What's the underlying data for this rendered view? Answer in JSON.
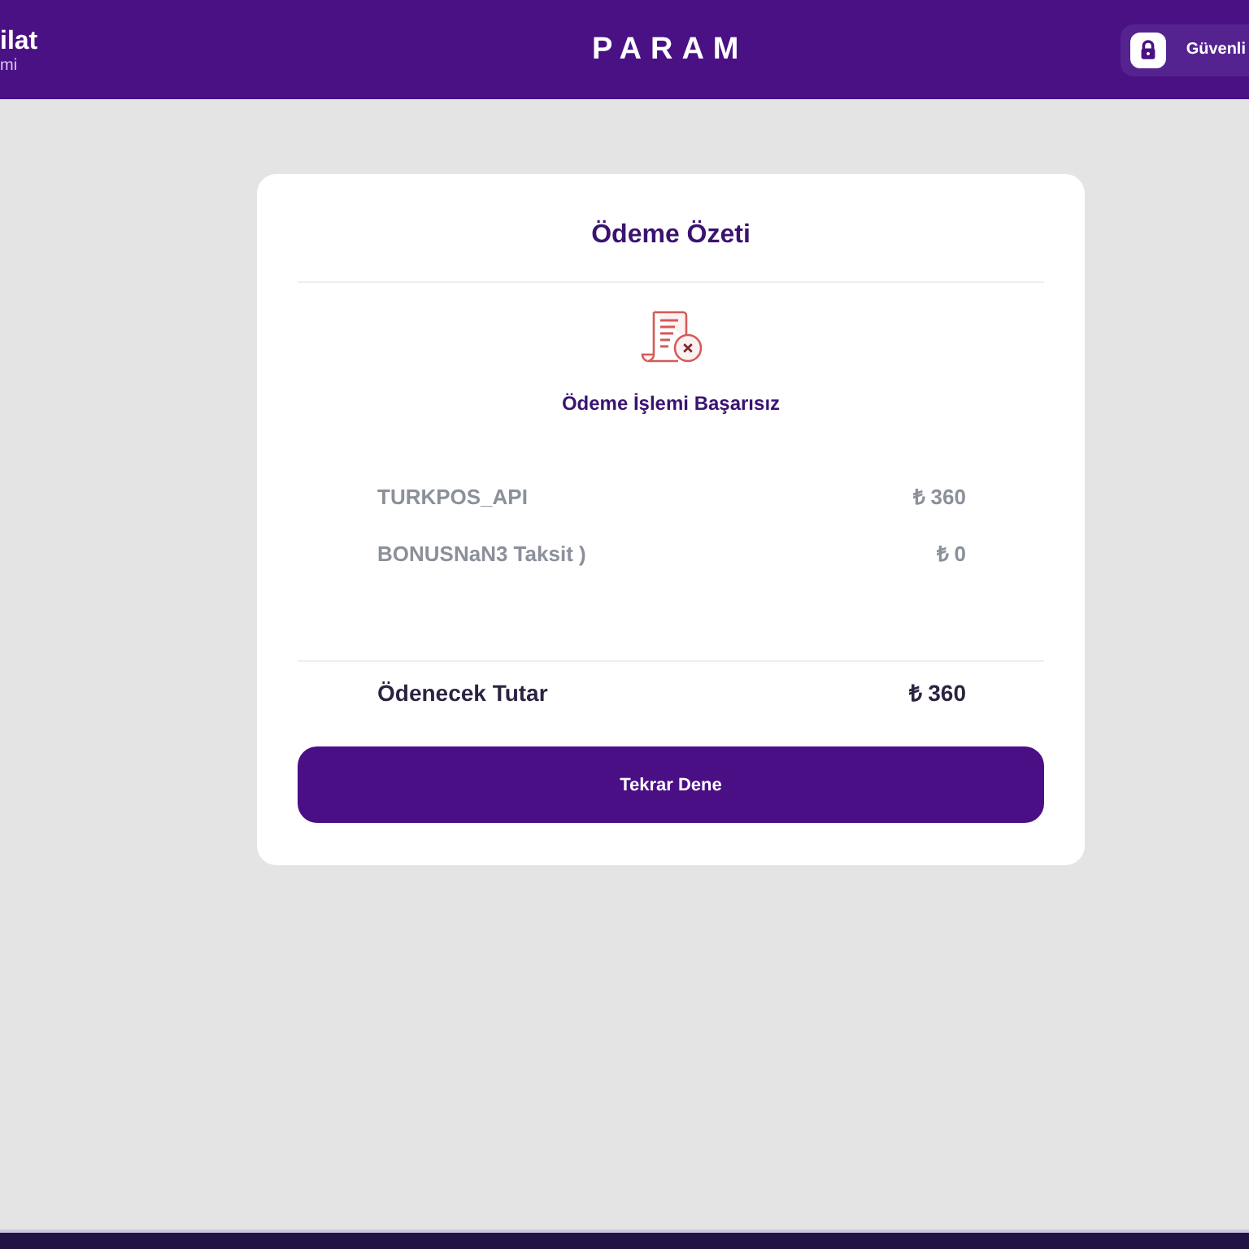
{
  "header": {
    "title": "ilat",
    "subtitle": "mi",
    "logo": "PARAM",
    "secure_badge": "Güvenli"
  },
  "summary": {
    "title": "Ödeme Özeti",
    "status": "Ödeme İşlemi Başarısız",
    "items": [
      {
        "label": "TURKPOS_API",
        "amount": "₺ 360"
      },
      {
        "label": "BONUSNaN3 Taksit )",
        "amount": "₺ 0"
      }
    ],
    "total": {
      "label": "Ödenecek Tutar",
      "amount": "₺ 360"
    },
    "button": "Tekrar Dene"
  }
}
